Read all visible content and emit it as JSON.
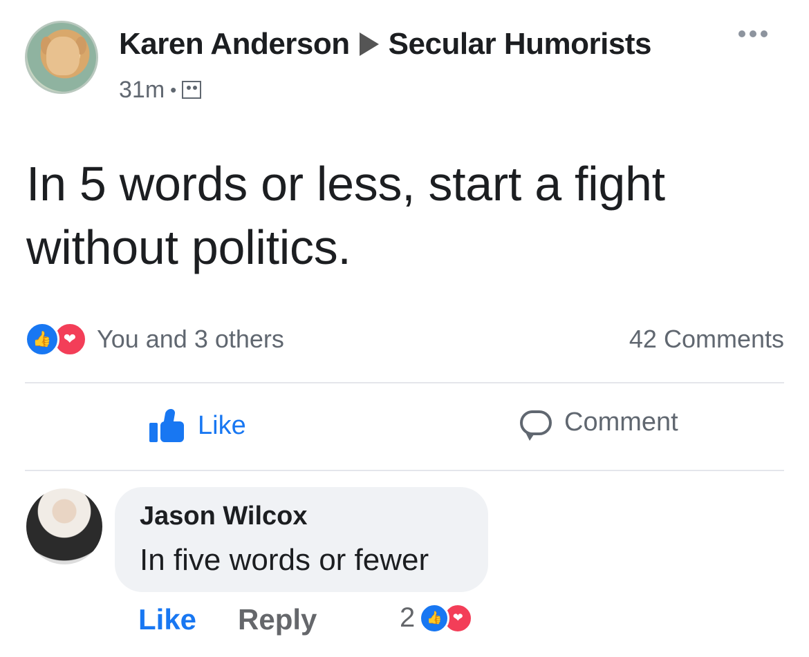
{
  "post": {
    "author": "Karen Anderson",
    "group": "Secular Humorists",
    "time": "31m",
    "separator": "•",
    "text": "In 5 words or less, start a fight without politics."
  },
  "reactions": {
    "summary": "You and 3 others",
    "comments_count": "42 Comments",
    "like_icon": "thumbs-up-icon",
    "love_icon": "heart-icon"
  },
  "actions": {
    "like_label": "Like",
    "comment_label": "Comment"
  },
  "comment": {
    "author": "Jason Wilcox",
    "text": "In five words or fewer",
    "like_label": "Like",
    "reply_label": "Reply",
    "reaction_count": "2"
  },
  "colors": {
    "accent": "#1877f2",
    "love": "#f33e58",
    "secondary_text": "#606770",
    "bubble": "#f0f2f5"
  }
}
